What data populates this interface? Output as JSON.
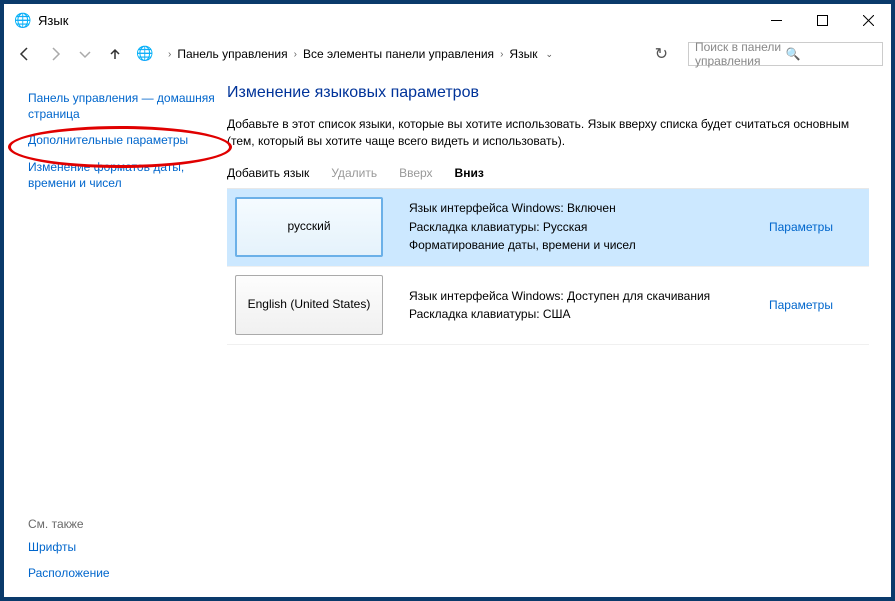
{
  "window": {
    "title": "Язык"
  },
  "breadcrumb": {
    "parts": [
      "Панель управления",
      "Все элементы панели управления",
      "Язык"
    ]
  },
  "search": {
    "placeholder": "Поиск в панели управления"
  },
  "sidebar": {
    "home": "Панель управления — домашняя страница",
    "advanced": "Дополнительные параметры",
    "dateformats": "Изменение форматов даты, времени и чисел",
    "see_also": "См. также",
    "fonts": "Шрифты",
    "location": "Расположение"
  },
  "main": {
    "heading": "Изменение языковых параметров",
    "subtitle": "Добавьте в этот список языки, которые вы хотите использовать. Язык вверху списка будет считаться основным (тем, который вы хотите чаще всего видеть и использовать)."
  },
  "toolbar": {
    "add": "Добавить язык",
    "remove": "Удалить",
    "up": "Вверх",
    "down": "Вниз"
  },
  "languages": [
    {
      "name": "русский",
      "details": "Язык интерфейса Windows: Включен\nРаскладка клавиатуры: Русская\nФорматирование даты, времени и чисел",
      "options": "Параметры",
      "selected": true
    },
    {
      "name": "English (United States)",
      "details": "Язык интерфейса Windows: Доступен для скачивания\nРаскладка клавиатуры: США",
      "options": "Параметры",
      "selected": false
    }
  ]
}
